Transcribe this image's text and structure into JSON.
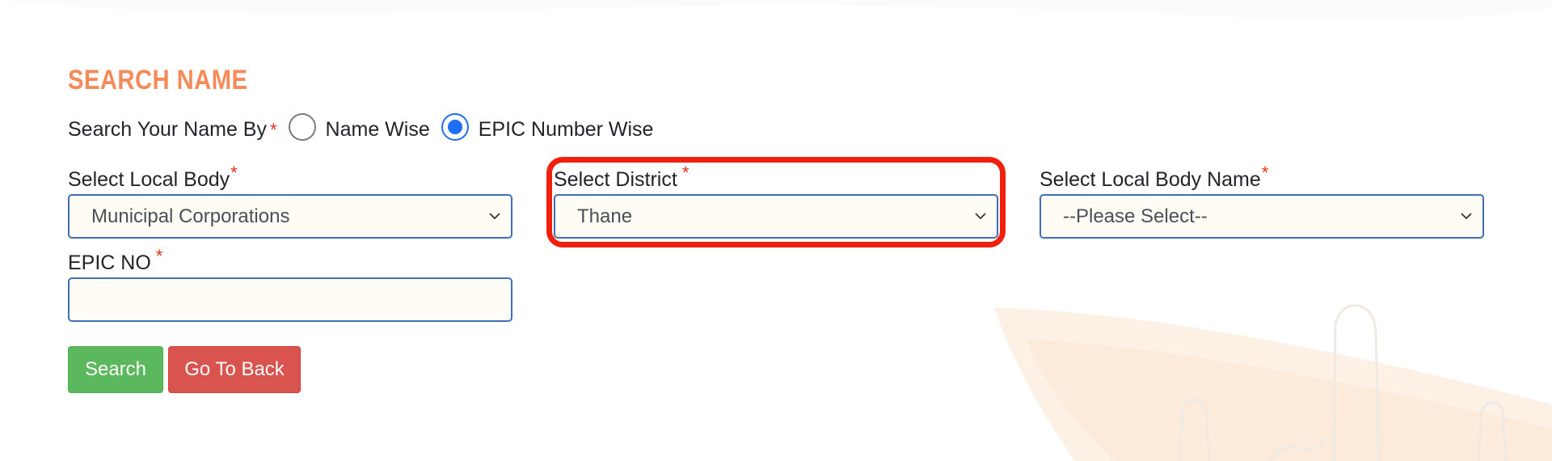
{
  "page": {
    "title": "SEARCH NAME"
  },
  "search_by": {
    "label": "Search Your Name By",
    "required_mark": "*",
    "options": [
      {
        "label": "Name Wise",
        "selected": false
      },
      {
        "label": "EPIC Number Wise",
        "selected": true
      }
    ]
  },
  "fields": {
    "local_body": {
      "label": "Select Local Body",
      "required_mark": "*",
      "value": "Municipal Corporations"
    },
    "district": {
      "label": "Select District",
      "required_mark": "*",
      "value": "Thane"
    },
    "local_body_name": {
      "label": "Select Local Body Name",
      "required_mark": "*",
      "value": "--Please Select--"
    },
    "epic_no": {
      "label": "EPIC NO",
      "required_mark": "*",
      "value": ""
    }
  },
  "buttons": {
    "search": "Search",
    "back": "Go To Back"
  },
  "colors": {
    "title": "#f68b5a",
    "required": "#e3321b",
    "field_border": "#3f6fb6",
    "field_bg": "#fffcf5",
    "search_button": "#5cb85c",
    "back_button": "#d9534f",
    "highlight": "#f0200c"
  }
}
